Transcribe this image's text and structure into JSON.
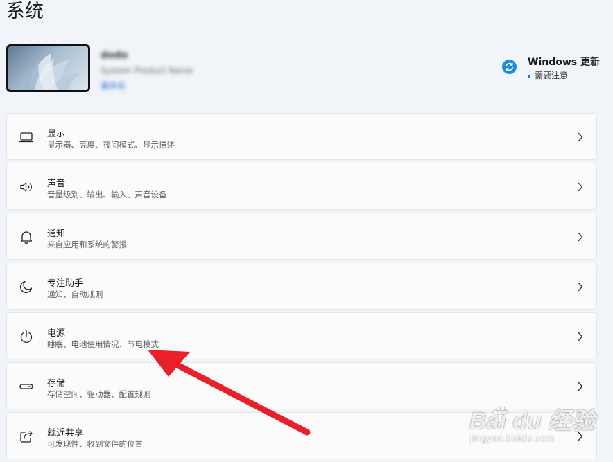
{
  "page": {
    "title": "系统"
  },
  "device": {
    "name": "dodo",
    "model": "System Product Name",
    "rename": "重命名"
  },
  "update": {
    "title": "Windows 更新",
    "status": "需要注意",
    "icon": "sync-icon",
    "accent": "#1a8fd8"
  },
  "items": [
    {
      "title": "显示",
      "desc": "显示器、亮度、夜间模式、显示描述",
      "icon": "monitor-icon"
    },
    {
      "title": "声音",
      "desc": "音量级别、输出、输入、声音设备",
      "icon": "speaker-icon"
    },
    {
      "title": "通知",
      "desc": "来自应用和系统的警报",
      "icon": "bell-icon"
    },
    {
      "title": "专注助手",
      "desc": "通知、自动规则",
      "icon": "moon-icon"
    },
    {
      "title": "电源",
      "desc": "睡眠、电池使用情况、节电模式",
      "icon": "power-icon"
    },
    {
      "title": "存储",
      "desc": "存储空间、驱动器、配置规则",
      "icon": "drive-icon"
    },
    {
      "title": "就近共享",
      "desc": "可发现性、收到文件的位置",
      "icon": "share-icon"
    }
  ],
  "watermark": {
    "main": "Bai du 经验",
    "sub": "jingyan.baidu.com"
  },
  "colors": {
    "background": "#f1f4f9",
    "card": "#fbfbfc",
    "arrow": "#e8202a"
  }
}
